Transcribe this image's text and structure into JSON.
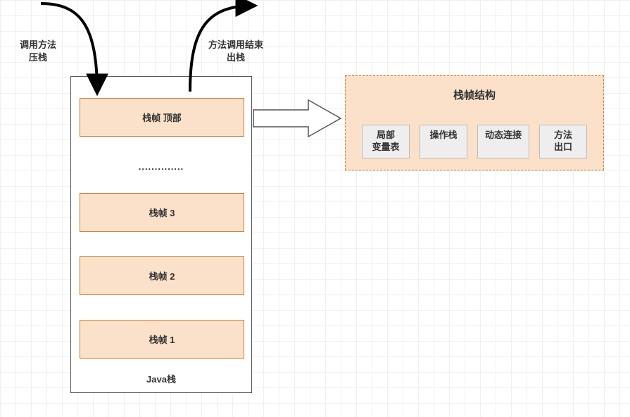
{
  "annotations": {
    "push_label_line1": "调用方法",
    "push_label_line2": "压栈",
    "pop_label_line1": "方法调用结束",
    "pop_label_line2": "出栈"
  },
  "stack": {
    "title": "Java栈",
    "ellipsis": "..............",
    "frames": {
      "top": "栈帧 顶部",
      "f3": "栈帧 3",
      "f2": "栈帧 2",
      "f1": "栈帧 1"
    }
  },
  "frame_structure": {
    "title": "栈帧结构",
    "items": {
      "lvt_line1": "局部",
      "lvt_line2": "变量表",
      "opstack": "操作栈",
      "dynlink": "动态连接",
      "exit_line1": "方法",
      "exit_line2": "出口"
    }
  }
}
